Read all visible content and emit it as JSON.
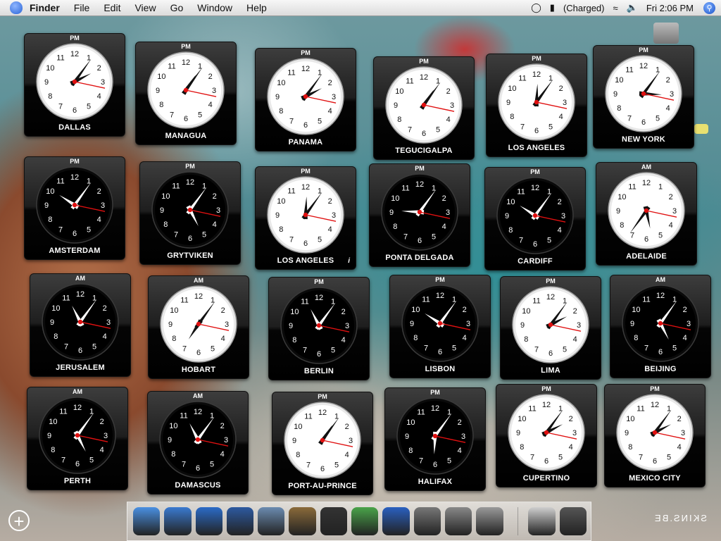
{
  "menubar": {
    "app": "Finder",
    "items": [
      "File",
      "Edit",
      "View",
      "Go",
      "Window",
      "Help"
    ],
    "battery": "(Charged)",
    "clock": "Fri 2:06 PM"
  },
  "widgets": [
    {
      "city": "DALLAS",
      "ampm": "PM",
      "face": "light",
      "hour": 2,
      "minute": 6,
      "second": 17
    },
    {
      "city": "MANAGUA",
      "ampm": "PM",
      "face": "light",
      "hour": 1,
      "minute": 6,
      "second": 17
    },
    {
      "city": "PANAMA",
      "ampm": "PM",
      "face": "light",
      "hour": 2,
      "minute": 6,
      "second": 17
    },
    {
      "city": "TEGUCIGALPA",
      "ampm": "PM",
      "face": "light",
      "hour": 1,
      "minute": 6,
      "second": 17
    },
    {
      "city": "LOS ANGELES",
      "ampm": "PM",
      "face": "light",
      "hour": 12,
      "minute": 6,
      "second": 17
    },
    {
      "city": "NEW YORK",
      "ampm": "PM",
      "face": "light",
      "hour": 3,
      "minute": 6,
      "second": 17
    },
    {
      "city": "AMSTERDAM",
      "ampm": "PM",
      "face": "dark",
      "hour": 10,
      "minute": 6,
      "second": 17
    },
    {
      "city": "GRYTVIKEN",
      "ampm": "PM",
      "face": "dark",
      "hour": 5,
      "minute": 6,
      "second": 17
    },
    {
      "city": "LOS ANGELES",
      "ampm": "PM",
      "face": "light",
      "hour": 12,
      "minute": 6,
      "second": 17,
      "info": "i"
    },
    {
      "city": "PONTA DELGADA",
      "ampm": "PM",
      "face": "dark",
      "hour": 9,
      "minute": 6,
      "second": 17
    },
    {
      "city": "CARDIFF",
      "ampm": "PM",
      "face": "dark",
      "hour": 10,
      "minute": 6,
      "second": 17
    },
    {
      "city": "ADELAIDE",
      "ampm": "AM",
      "face": "light",
      "hour": 5,
      "minute": 36,
      "second": 17
    },
    {
      "city": "JERUSALEM",
      "ampm": "AM",
      "face": "dark",
      "hour": 11,
      "minute": 6,
      "second": 17
    },
    {
      "city": "HOBART",
      "ampm": "AM",
      "face": "light",
      "hour": 7,
      "minute": 6,
      "second": 17
    },
    {
      "city": "BERLIN",
      "ampm": "PM",
      "face": "dark",
      "hour": 11,
      "minute": 6,
      "second": 17
    },
    {
      "city": "LISBON",
      "ampm": "PM",
      "face": "dark",
      "hour": 10,
      "minute": 6,
      "second": 17
    },
    {
      "city": "LIMA",
      "ampm": "PM",
      "face": "light",
      "hour": 2,
      "minute": 6,
      "second": 17
    },
    {
      "city": "BEIJING",
      "ampm": "AM",
      "face": "dark",
      "hour": 5,
      "minute": 6,
      "second": 17
    },
    {
      "city": "PERTH",
      "ampm": "AM",
      "face": "dark",
      "hour": 5,
      "minute": 6,
      "second": 17
    },
    {
      "city": "DAMASCUS",
      "ampm": "AM",
      "face": "dark",
      "hour": 11,
      "minute": 6,
      "second": 17
    },
    {
      "city": "PORT-AU-PRINCE",
      "ampm": "PM",
      "face": "light",
      "hour": 1,
      "minute": 6,
      "second": 17
    },
    {
      "city": "HALIFAX",
      "ampm": "PM",
      "face": "dark",
      "hour": 6,
      "minute": 6,
      "second": 17
    },
    {
      "city": "CUPERTINO",
      "ampm": "PM",
      "face": "light",
      "hour": 2,
      "minute": 6,
      "second": 17
    },
    {
      "city": "MEXICO CITY",
      "ampm": "PM",
      "face": "light",
      "hour": 2,
      "minute": 6,
      "second": 17
    }
  ],
  "watermark": "SKINS.BE",
  "dock_items": [
    "finder-icon",
    "ichat-icon",
    "safari-icon",
    "mail-icon",
    "iphoto-icon",
    "iphoto-icon-2",
    "imovie-icon",
    "itunes-icon",
    "word-icon",
    "utilities-icon",
    "system-profiler-icon",
    "sys-prefs-icon",
    "printer-icon",
    "trash-icon"
  ]
}
